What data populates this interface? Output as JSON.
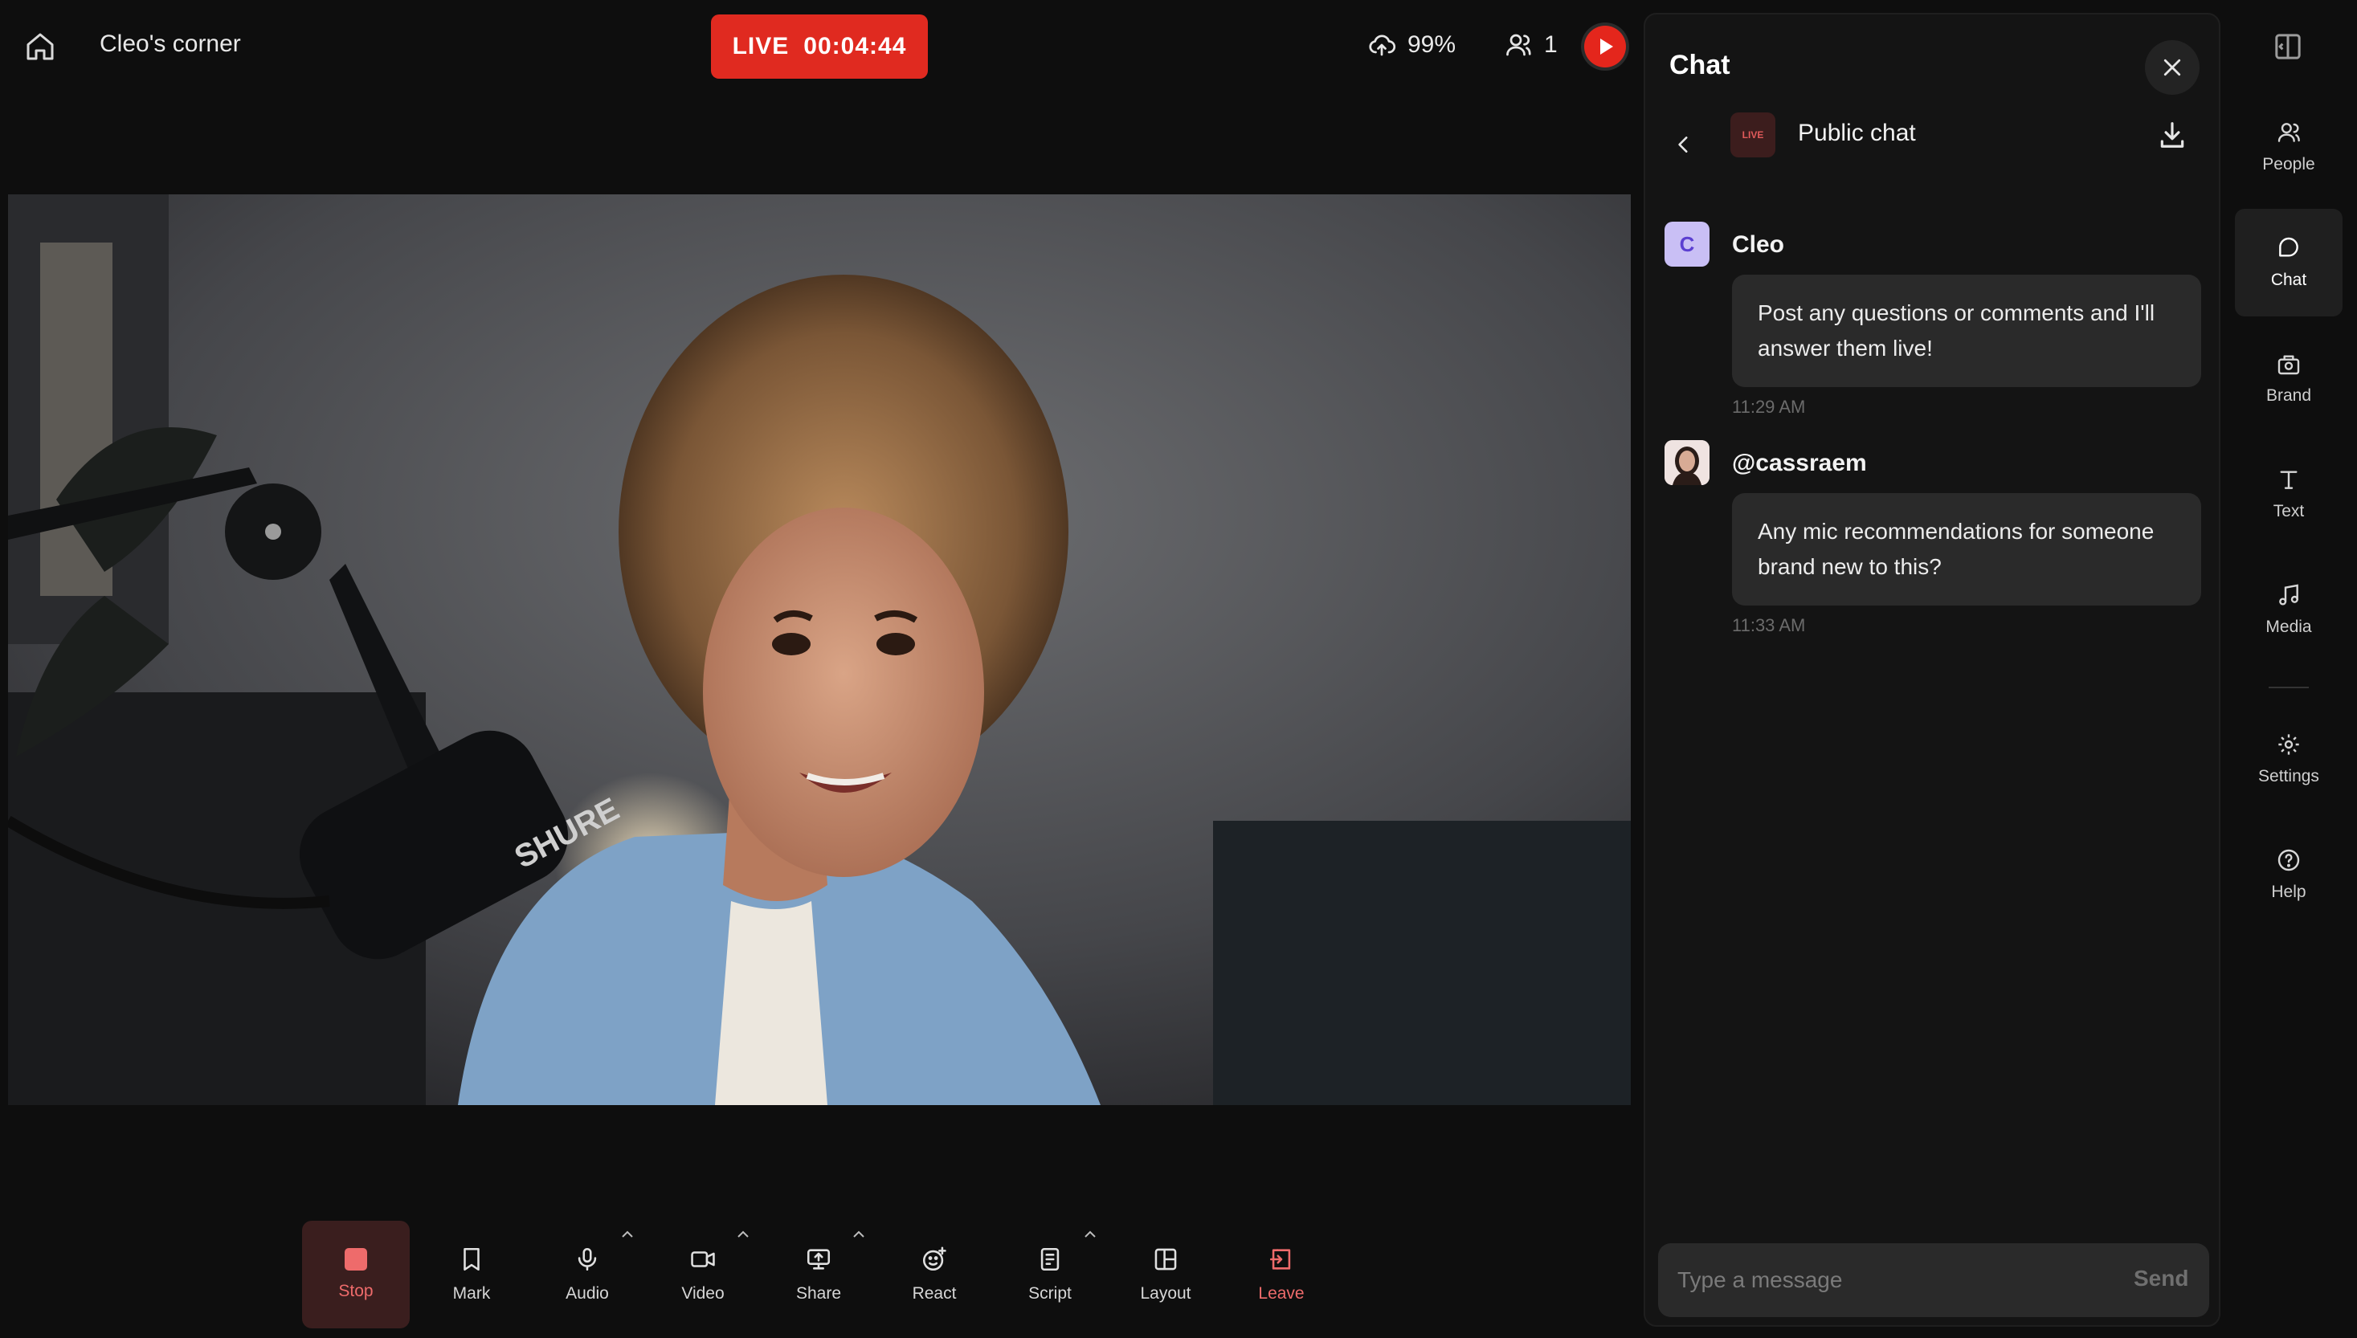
{
  "header": {
    "title": "Cleo's corner",
    "live_label": "LIVE",
    "timer": "00:04:44",
    "upload_quality": "99%",
    "viewer_count": "1"
  },
  "toolbar": {
    "stop": "Stop",
    "mark": "Mark",
    "audio": "Audio",
    "video": "Video",
    "share": "Share",
    "react": "React",
    "script": "Script",
    "layout": "Layout",
    "leave": "Leave"
  },
  "chat": {
    "title": "Chat",
    "channel_badge": "LIVE",
    "channel_name": "Public chat",
    "messages": [
      {
        "avatar": "C",
        "author": "Cleo",
        "text": "Post any questions or comments and I'll answer them live!",
        "time": "11:29 AM"
      },
      {
        "avatar": "",
        "author": "@cassraem",
        "text": "Any mic recommendations for someone brand new to this?",
        "time": "11:33 AM"
      }
    ],
    "composer_placeholder": "Type a message",
    "send_label": "Send"
  },
  "rail": {
    "people": "People",
    "chat": "Chat",
    "brand": "Brand",
    "text": "Text",
    "media": "Media",
    "settings": "Settings",
    "help": "Help"
  },
  "colors": {
    "live_red": "#e02a20",
    "stop_red": "#ee6b6b",
    "panel_bg": "#141414"
  }
}
